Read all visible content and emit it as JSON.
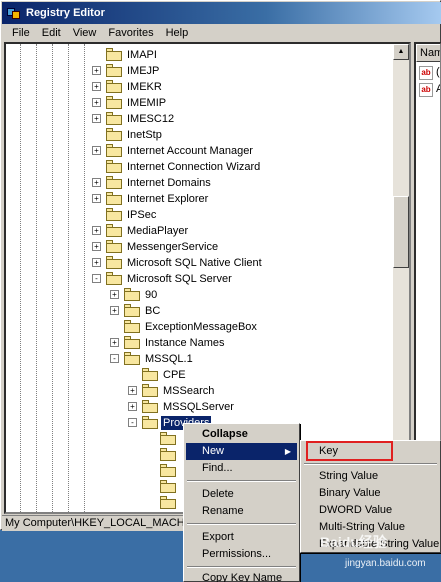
{
  "window": {
    "title": "Registry Editor"
  },
  "menubar": [
    {
      "label": "File"
    },
    {
      "label": "Edit"
    },
    {
      "label": "View"
    },
    {
      "label": "Favorites"
    },
    {
      "label": "Help"
    }
  ],
  "tree": {
    "nodes": [
      {
        "label": "IMAPI",
        "expander": "",
        "depth": 0
      },
      {
        "label": "IMEJP",
        "expander": "+",
        "depth": 0
      },
      {
        "label": "IMEKR",
        "expander": "+",
        "depth": 0
      },
      {
        "label": "IMEMIP",
        "expander": "+",
        "depth": 0
      },
      {
        "label": "IMESC12",
        "expander": "+",
        "depth": 0
      },
      {
        "label": "InetStp",
        "expander": "",
        "depth": 0
      },
      {
        "label": "Internet Account Manager",
        "expander": "+",
        "depth": 0
      },
      {
        "label": "Internet Connection Wizard",
        "expander": "",
        "depth": 0
      },
      {
        "label": "Internet Domains",
        "expander": "+",
        "depth": 0
      },
      {
        "label": "Internet Explorer",
        "expander": "+",
        "depth": 0
      },
      {
        "label": "IPSec",
        "expander": "",
        "depth": 0
      },
      {
        "label": "MediaPlayer",
        "expander": "+",
        "depth": 0
      },
      {
        "label": "MessengerService",
        "expander": "+",
        "depth": 0
      },
      {
        "label": "Microsoft SQL Native Client",
        "expander": "+",
        "depth": 0
      },
      {
        "label": "Microsoft SQL Server",
        "expander": "-",
        "depth": 0
      },
      {
        "label": "90",
        "expander": "+",
        "depth": 1
      },
      {
        "label": "BC",
        "expander": "+",
        "depth": 1
      },
      {
        "label": "ExceptionMessageBox",
        "expander": "",
        "depth": 1
      },
      {
        "label": "Instance Names",
        "expander": "+",
        "depth": 1
      },
      {
        "label": "MSSQL.1",
        "expander": "-",
        "depth": 1
      },
      {
        "label": "CPE",
        "expander": "",
        "depth": 2
      },
      {
        "label": "MSSearch",
        "expander": "+",
        "depth": 2
      },
      {
        "label": "MSSQLServer",
        "expander": "+",
        "depth": 2
      },
      {
        "label": "Providers",
        "expander": "-",
        "depth": 2,
        "selected": true
      },
      {
        "label": "",
        "expander": "",
        "depth": 3
      },
      {
        "label": "",
        "expander": "",
        "depth": 3
      },
      {
        "label": "",
        "expander": "",
        "depth": 3
      },
      {
        "label": "",
        "expander": "",
        "depth": 3
      },
      {
        "label": "",
        "expander": "",
        "depth": 3
      }
    ]
  },
  "right_pane": {
    "header": "Nam",
    "items": [
      {
        "icon": "ab",
        "label": "("
      },
      {
        "icon": "ab",
        "label": "A"
      }
    ]
  },
  "status": {
    "text": "My Computer\\HKEY_LOCAL_MACHIN"
  },
  "context_menu": {
    "items": [
      {
        "label": "Collapse",
        "bold": true
      },
      {
        "label": "New",
        "submenu": true,
        "highlighted": true
      },
      {
        "label": "Find..."
      },
      {
        "label": "Delete"
      },
      {
        "label": "Rename"
      },
      {
        "label": "Export"
      },
      {
        "label": "Permissions..."
      },
      {
        "label": "Copy Key Name"
      }
    ]
  },
  "submenu": {
    "items": [
      {
        "label": "Key"
      },
      {
        "label": "String Value"
      },
      {
        "label": "Binary Value"
      },
      {
        "label": "DWORD Value"
      },
      {
        "label": "Multi-String Value"
      },
      {
        "label": "Expandable String Value"
      }
    ]
  },
  "watermark": {
    "logo": "Baidu经验",
    "url": "jingyan.baidu.com"
  }
}
